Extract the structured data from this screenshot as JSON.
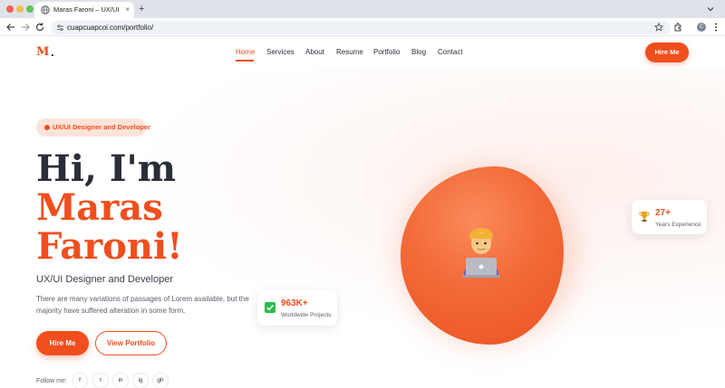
{
  "browser": {
    "tab_title": "Maras Faroni – UX/UI Designer",
    "tab_close": "×",
    "new_tab": "+",
    "url": "cuapcuapcoi.com/portfolio/",
    "profile_initial": "C"
  },
  "header": {
    "logo_letter": "M",
    "logo_dot": ".",
    "nav": [
      "Home",
      "Services",
      "About",
      "Resume",
      "Portfolio",
      "Blog",
      "Contact"
    ],
    "active_nav": "Home",
    "hire_label": "Hire Me"
  },
  "hero": {
    "badge": "UX/UI Designer and Developer",
    "line1": "Hi, I'm",
    "line2": "Maras",
    "line3": "Faroni!",
    "subtitle": "UX/UI Designer and Developer",
    "description": "There are many variations of passages of Lorem available, but the majority have suffered alteration in some form.",
    "hire_label": "Hire Me",
    "portfolio_label": "View Portfolio",
    "follow_label": "Follow me:",
    "socials": [
      "f",
      "t",
      "in",
      "ig",
      "gh"
    ]
  },
  "stats": {
    "projects_value": "963K+",
    "projects_label": "Worldwide Projects",
    "experience_value": "27+",
    "experience_label": "Years Experience"
  },
  "colors": {
    "accent": "#f04e1d",
    "dark_text": "#2a2e39"
  }
}
